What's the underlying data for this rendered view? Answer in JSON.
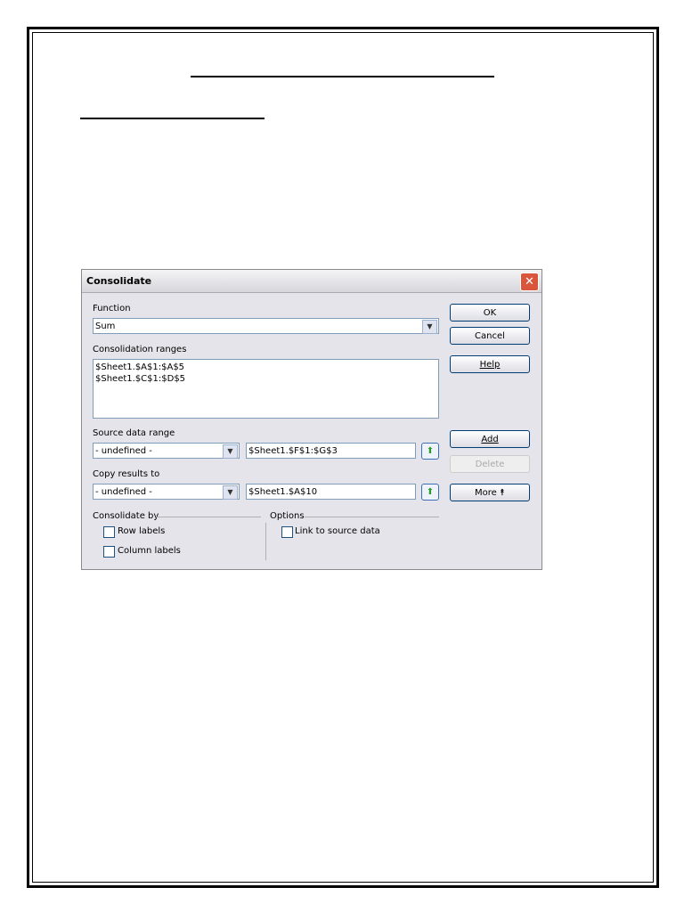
{
  "dialog": {
    "title": "Consolidate",
    "function_label": "Function",
    "function_value": "Sum",
    "ranges_label": "Consolidation ranges",
    "ranges": [
      "$Sheet1.$A$1:$A$5",
      "$Sheet1.$C$1:$D$5"
    ],
    "source_label": "Source data range",
    "source_select": "- undefined -",
    "source_value": "$Sheet1.$F$1:$G$3",
    "copy_label": "Copy results to",
    "copy_select": "- undefined -",
    "copy_value": "$Sheet1.$A$10",
    "consolidate_by": "Consolidate by",
    "row_labels": "Row labels",
    "column_labels": "Column labels",
    "options": "Options",
    "link": "Link to source data",
    "buttons": {
      "ok": "OK",
      "cancel": "Cancel",
      "help": "Help",
      "add": "Add",
      "delete": "Delete",
      "more": "More ⯭"
    }
  }
}
